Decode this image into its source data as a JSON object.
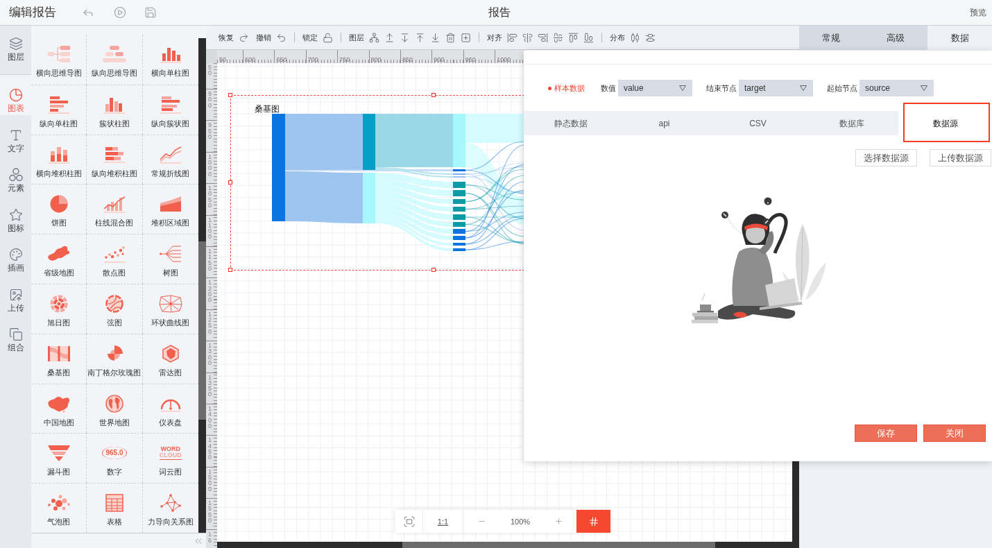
{
  "header": {
    "title": "编辑报告",
    "document_title": "报告",
    "preview": "预览"
  },
  "rail": [
    {
      "label": "图层",
      "selected": false
    },
    {
      "label": "图表",
      "selected": true
    },
    {
      "label": "文字",
      "selected": false
    },
    {
      "label": "元素",
      "selected": false
    },
    {
      "label": "图标",
      "selected": false
    },
    {
      "label": "插画",
      "selected": false
    },
    {
      "label": "上传",
      "selected": false
    },
    {
      "label": "组合",
      "selected": false
    }
  ],
  "chart_types": [
    {
      "label": "横向思维导图",
      "kind": "drawing"
    },
    {
      "label": "纵向思维导图",
      "kind": "drawing"
    },
    {
      "label": "横向单柱图",
      "kind": "drawing"
    },
    {
      "label": "纵向单柱图",
      "kind": "drawing"
    },
    {
      "label": "簇状柱图",
      "kind": "drawing"
    },
    {
      "label": "纵向簇状图",
      "kind": "drawing"
    },
    {
      "label": "横向堆积柱图",
      "kind": "drawing"
    },
    {
      "label": "纵向堆积柱图",
      "kind": "drawing"
    },
    {
      "label": "常规折线图",
      "kind": "drawing"
    },
    {
      "label": "饼图",
      "kind": "drawing"
    },
    {
      "label": "柱线混合图",
      "kind": "drawing"
    },
    {
      "label": "堆积区域图",
      "kind": "drawing"
    },
    {
      "label": "省级地图",
      "kind": "drawing"
    },
    {
      "label": "散点图",
      "kind": "drawing"
    },
    {
      "label": "树图",
      "kind": "drawing"
    },
    {
      "label": "旭日图",
      "kind": "drawing"
    },
    {
      "label": "弦图",
      "kind": "drawing"
    },
    {
      "label": "环状曲线图",
      "kind": "drawing"
    },
    {
      "label": "桑基图",
      "kind": "drawing"
    },
    {
      "label": "南丁格尔玫瑰图",
      "kind": "drawing"
    },
    {
      "label": "雷达图",
      "kind": "drawing"
    },
    {
      "label": "中国地图",
      "kind": "drawing"
    },
    {
      "label": "世界地图",
      "kind": "drawing"
    },
    {
      "label": "仪表盘",
      "kind": "drawing"
    },
    {
      "label": "漏斗图",
      "kind": "drawing"
    },
    {
      "label": "数字",
      "kind": "number"
    },
    {
      "label": "词云图",
      "kind": "word_cloud"
    },
    {
      "label": "气泡图",
      "kind": "drawing"
    },
    {
      "label": "表格",
      "kind": "drawing"
    },
    {
      "label": "力导向关系图",
      "kind": "drawing"
    }
  ],
  "chart_icon_texts": [
    {
      "kind": "number",
      "text": "965.0"
    },
    {
      "kind": "word_cloud",
      "lines": [
        "WORD",
        "CLOUD"
      ]
    }
  ],
  "toolbar": [
    {
      "label": "恢复"
    },
    {
      "label": "撤销"
    },
    {
      "label": "锁定"
    },
    {
      "label": "图层"
    },
    {
      "label": "对齐"
    },
    {
      "label": "分布"
    }
  ],
  "rulers": {
    "horizontal": [
      "50",
      "600",
      "650",
      "700",
      "750",
      "800",
      "850",
      "900",
      "950",
      "1000"
    ],
    "vertical": [
      "50",
      "900",
      "950",
      "1000",
      "1050",
      "1100",
      "1150",
      "1200",
      "1250",
      "1300",
      "1350",
      "1400",
      "1450",
      "1500",
      "1550",
      "16"
    ]
  },
  "canvas": {
    "component": {
      "title": "桑基图",
      "selected": true
    }
  },
  "zoom_bar": {
    "actual_size": "1:1",
    "zoom": "100%",
    "grid_on": true
  },
  "properties": {
    "tabs": [
      {
        "label": "常规",
        "selected": false
      },
      {
        "label": "高级",
        "selected": false
      },
      {
        "label": "数据",
        "selected": true
      }
    ]
  },
  "data_dialog": {
    "sample_data": "样本数据",
    "fields": [
      {
        "label": "数值",
        "value": "value"
      },
      {
        "label": "结束节点",
        "value": "target"
      },
      {
        "label": "起始节点",
        "value": "source"
      }
    ],
    "source_tabs": [
      {
        "label": "静态数据",
        "selected": false,
        "highlighted": false
      },
      {
        "label": "api",
        "selected": false,
        "highlighted": false
      },
      {
        "label": "CSV",
        "selected": false,
        "highlighted": false
      },
      {
        "label": "数据库",
        "selected": false,
        "highlighted": false
      },
      {
        "label": "数据源",
        "selected": true,
        "highlighted": true
      }
    ],
    "source_actions": [
      "选择数据源",
      "上传数据源"
    ],
    "buttons": [
      "保存",
      "关闭"
    ]
  }
}
